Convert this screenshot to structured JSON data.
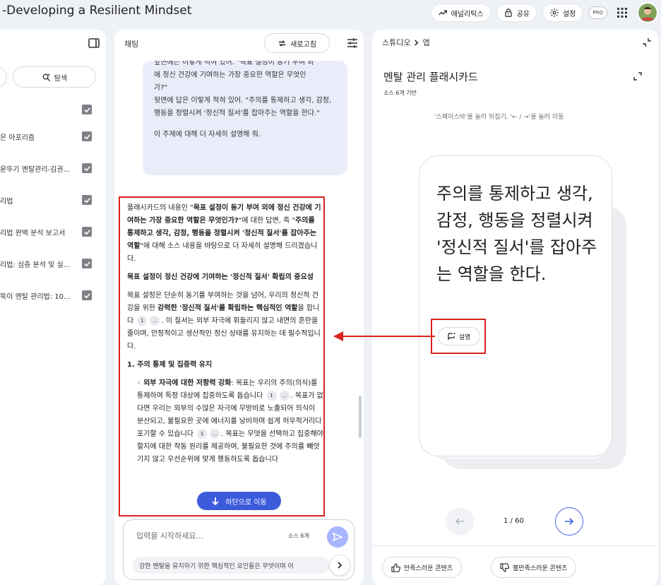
{
  "app": {
    "title": "-Developing a Resilient Mindset",
    "analytics_label": "애널리틱스",
    "share_label": "공유",
    "settings_label": "설정",
    "pro_badge": "PRO"
  },
  "sources": {
    "explore_label": "탐색",
    "items": [
      {
        "label": "",
        "checked": true
      },
      {
        "label": "은 아포리즘",
        "checked": true
      },
      {
        "label": "운뚜기 멘탈관리-김권...",
        "checked": true
      },
      {
        "label": "리법",
        "checked": true
      },
      {
        "label": "리법 완벽 분석 보고서",
        "checked": true
      },
      {
        "label": "리법: 심층 분석 및 실...",
        "checked": true
      },
      {
        "label": "뚝이 멘탈 관리법: 10...",
        "checked": true
      }
    ]
  },
  "chat": {
    "title": "채팅",
    "refresh_label": "새로고침",
    "user_message": {
      "line_partial": "앞면에는 이렇게 적혀 있어. \"목표 설정이 동기 부여 외",
      "line2": "에 정신 건강에 기여하는 가장 중요한 역할은 무엇인",
      "line3": "가?\"",
      "back": "뒷면에 답은 이렇게 적혀 있어. \"주의를 통제하고 생각, 감정, 행동을 정렬시켜 '정신적 질서'를 잡아주는 역할을 한다.\"",
      "request": "이 주제에 대해 더 자세히 설명해 줘."
    },
    "answer": {
      "intro_pre": "플래시카드의 내용인 \"",
      "intro_q": "목표 설정이 동기 부여 외에 정신 건강에 기여하는 가장 중요한 역할은 무엇인가?",
      "intro_mid": "\"에 대한 답변, 즉 \"",
      "intro_a": "주의를 통제하고 생각, 감정, 행동을 정렬시켜 '정신적 질서'를 잡아주는 역할",
      "intro_post": "\"에 대해 소스 내용을 바탕으로 더 자세히 설명해 드리겠습니다.",
      "heading": "목표 설정이 정신 건강에 기여하는 '정신적 질서' 확립의 중요성",
      "p2_pre": "목표 설정은 단순히 동기를 부여하는 것을 넘어, 우리의 정신적 건강을 위한 ",
      "p2_bold": "강력한 '정신적 질서'를 확립하는 핵심적인 역할",
      "p2_mid": "을 합니다",
      "p2_post": ". 이 질서는 외부 자극에 휘둘리지 않고 내면의 혼란을 줄이며, 안정적이고 생산적인 정신 상태를 유지하는 데 필수적입니다.",
      "section1": "1. 주의 통제 및 집중력 유지",
      "bullet_bold": "외부 자극에 대한 저항력 강화",
      "bullet_pre": ": 목표는 우리의 주의(의식)를 통제하여 특정 대상에 집중하도록 돕습니다",
      "bullet_mid": ". 목표가 없다면 우리는 외부의 수많은 자극에 무방비로 노출되어 의식이 분산되고, 불필요한 곳에 에너지를 낭비하며 쉽게 허우적거리다 포기할 수 있습니다",
      "bullet_end": "목표는 무엇을 선택하고 집중해야 할지에 대한 작동 원리를 제공하여, 불필요한 것에 주의를 빼앗기지 않고 우선순위에 맞게 행동하도록 돕습니다",
      "cite_num": "1",
      "cite_more": "..."
    },
    "scroll_bottom_label": "하단으로 이동",
    "input_placeholder": "입력을 시작하세요...",
    "source_count": "소스 6개",
    "suggestion": "강한 멘탈을 유지하기 위한 핵심적인 요인들은 무엇이며 어"
  },
  "studio": {
    "breadcrumb_root": "스튜디오",
    "breadcrumb_current": "앱",
    "flashcard_title": "멘탈 관리 플래시카드",
    "source_basis": "소스 6개 기반",
    "hint": "'스페이스바'를 눌러 뒤집기, '← / →'를 눌러 이동",
    "card_text": "주의를 통제하고 생각, 감정, 행동을 정렬시켜 '정신적 질서'를 잡아주는 역할을 한다.",
    "explain_label": "설명",
    "pager": "1 / 60",
    "like_label": "만족스러운 콘텐츠",
    "dislike_label": "불만족스러운 콘텐츠"
  },
  "colors": {
    "annotation": "#d9231e",
    "accent": "#3b5bdb",
    "background": "#eef1f6"
  }
}
